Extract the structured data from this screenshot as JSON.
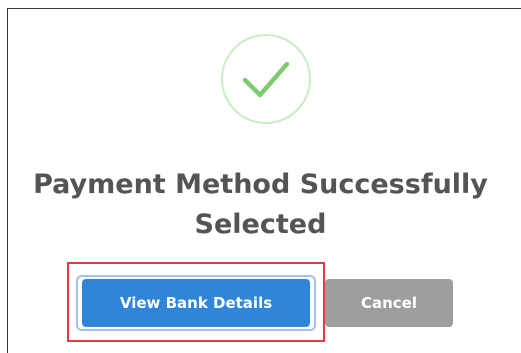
{
  "dialog": {
    "title": "Payment Method Successfully Selected",
    "icon": "check-circle-icon",
    "colors": {
      "check": "#7ccb6e",
      "check_ring": "#c9ecc5",
      "primary": "#2f86d8",
      "secondary": "#9e9e9e",
      "highlight": "#e53946"
    }
  },
  "actions": {
    "primary_label": "View Bank Details",
    "secondary_label": "Cancel"
  }
}
